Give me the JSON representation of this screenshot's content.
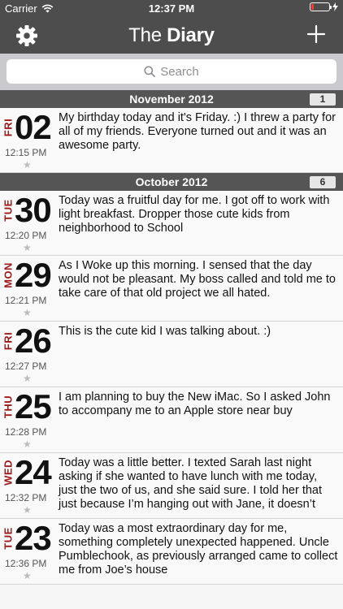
{
  "status": {
    "carrier": "Carrier",
    "time": "12:37 PM",
    "battery_level": 0.12
  },
  "nav": {
    "title_light": "The",
    "title_bold": "Diary",
    "settings_icon": "gear-icon",
    "add_icon": "plus-icon"
  },
  "search": {
    "placeholder": "Search"
  },
  "colors": {
    "bar": "#4d4d4d",
    "weekday": "#9b1b1b",
    "section": "#555555"
  },
  "sections": [
    {
      "title": "November 2012",
      "count": "1",
      "entries": [
        {
          "dow": "FRI",
          "day": "02",
          "time": "12:15 PM",
          "text": "My birthday today and it's Friday. :) I threw a party for all of my friends. Everyone turned out and it was an awesome party."
        }
      ]
    },
    {
      "title": "October 2012",
      "count": "6",
      "entries": [
        {
          "dow": "TUE",
          "day": "30",
          "time": "12:20 PM",
          "text": "Today was a fruitful day for me. I got off to work with light breakfast. Dropper those cute kids from neighborhood to School"
        },
        {
          "dow": "MON",
          "day": "29",
          "time": "12:21 PM",
          "text": "As I Woke up this morning. I sensed that the day would not be pleasant. My boss called and told me to take care of that old project we all hated."
        },
        {
          "dow": "FRI",
          "day": "26",
          "time": "12:27 PM",
          "text": "This is the cute kid I was talking about. :)"
        },
        {
          "dow": "THU",
          "day": "25",
          "time": "12:28 PM",
          "text": "I am planning to buy the New iMac. So I asked John to accompany me to an Apple store near buy"
        },
        {
          "dow": "WED",
          "day": "24",
          "time": "12:32 PM",
          "text": "Today was a little better. I texted Sarah last night asking if she wanted to have lunch with me today, just the two of us, and she said sure. I told her that just because I’m hanging out with Jane, it doesn’t"
        },
        {
          "dow": "TUE",
          "day": "23",
          "time": "12:36 PM",
          "text": "Today was a most extraordinary day for me, something completely unexpected happened. Uncle Pumblechook, as previously arranged came to collect me from Joe’s house"
        }
      ]
    }
  ]
}
